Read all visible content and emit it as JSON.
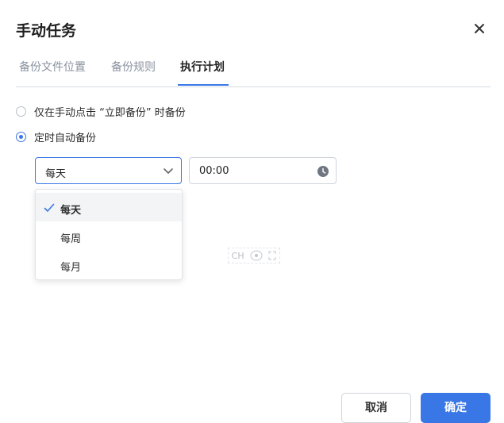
{
  "dialog": {
    "title": "手动任务"
  },
  "tabs": [
    {
      "label": "备份文件位置",
      "active": false
    },
    {
      "label": "备份规则",
      "active": false
    },
    {
      "label": "执行计划",
      "active": true
    }
  ],
  "schedule": {
    "option_manual": {
      "label": "仅在手动点击 “立即备份” 时备份",
      "checked": false
    },
    "option_timed": {
      "label": "定时自动备份",
      "checked": true
    },
    "frequency_select": {
      "value": "每天"
    },
    "time_input": {
      "value": "00:00"
    },
    "dropdown_options": [
      {
        "label": "每天",
        "selected": true
      },
      {
        "label": "每周",
        "selected": false
      },
      {
        "label": "每月",
        "selected": false
      }
    ]
  },
  "ime_toolbar": {
    "lang": "CH"
  },
  "footer": {
    "cancel_label": "取消",
    "ok_label": "确定"
  },
  "colors": {
    "accent": "#3a77e6",
    "border": "#cfd4db",
    "muted": "#8a93a0"
  }
}
